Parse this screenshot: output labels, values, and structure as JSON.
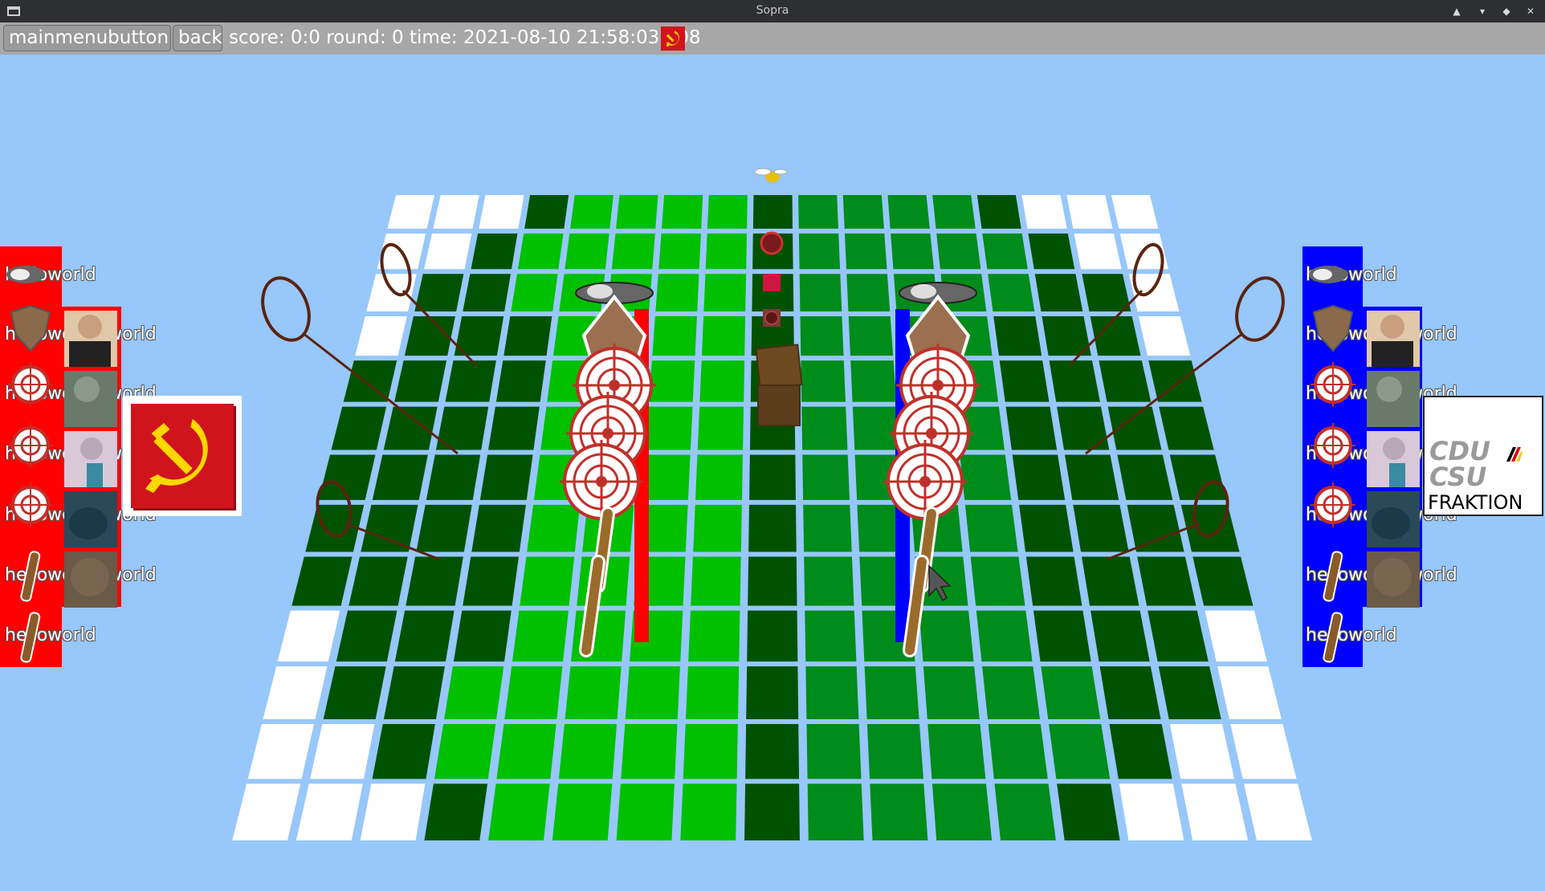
{
  "window": {
    "title": "Sopra"
  },
  "toolbar": {
    "mainmenu_label": "mainmenubutton",
    "back_label": "back",
    "status_text": "score: 0:0 round: 0 time: 2021-08-10 21:58:03.808"
  },
  "left_team": {
    "color": "#ff0000",
    "emblem": "hammer-sickle-icon",
    "player_labels": [
      "helloworld",
      "helloworld",
      "helloworld",
      "helloworld",
      "helloworld",
      "helloworld",
      "helloworld"
    ],
    "bench_labels": [
      "helloworld",
      "helloworld",
      "hellow",
      "helloworld",
      "helloworld"
    ]
  },
  "right_team": {
    "color": "#0000ff",
    "emblem_line1": "CDU",
    "emblem_line2": "CSU",
    "emblem_line3": "FRAKTION",
    "player_labels": [
      "helloworld",
      "helloworld",
      "helloworld",
      "helloworld",
      "helloworld",
      "helloworld",
      "helloworld"
    ],
    "bench_labels": [
      "helloworld",
      "helloworld",
      "hellow",
      "helloworld",
      "helloworld"
    ]
  },
  "colors": {
    "background": "#97c7fb",
    "light_green": "#00c000",
    "mid_green": "#008c1a",
    "dark_green": "#005200",
    "white_cell": "#ffffff"
  }
}
